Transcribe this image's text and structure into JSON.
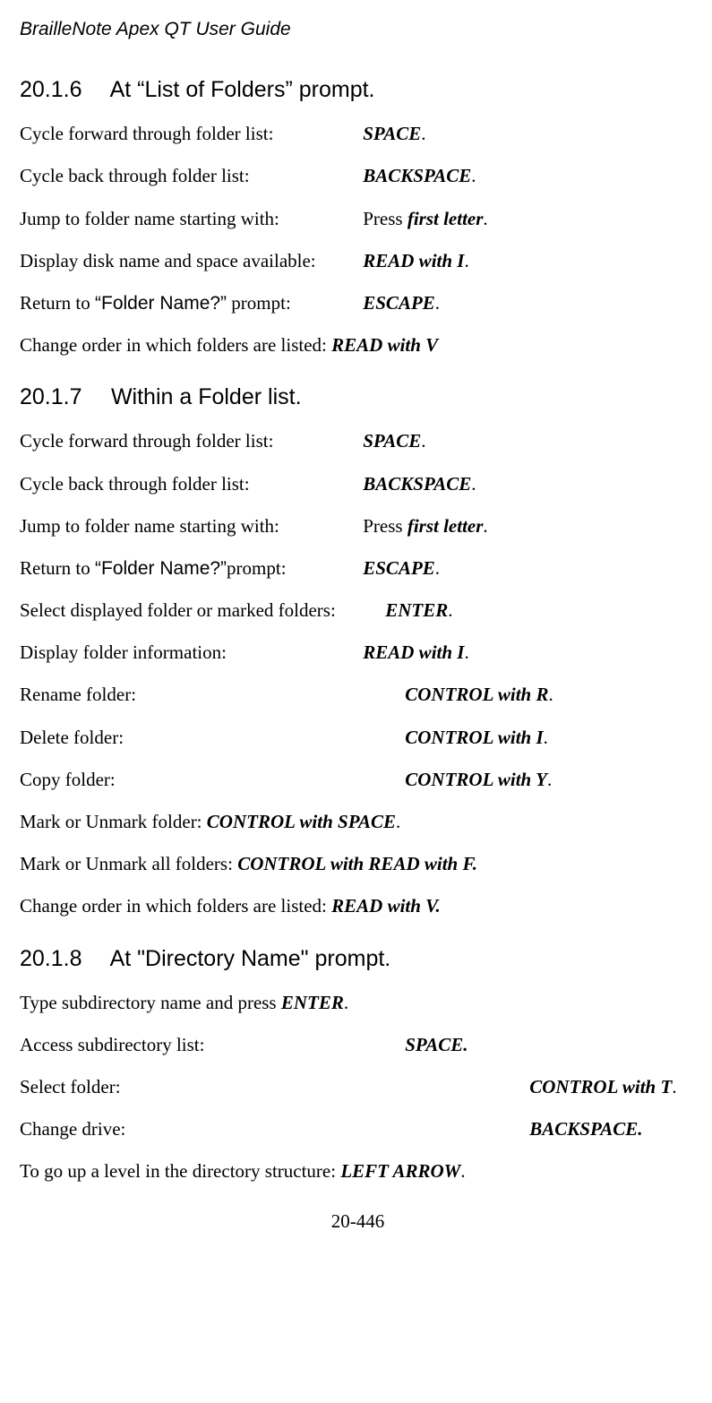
{
  "header": {
    "title": "BrailleNote Apex QT User Guide"
  },
  "sections": {
    "s1": {
      "num": "20.1.6",
      "title": "At “List of Folders” prompt.",
      "entries": {
        "e1": {
          "desc": "Cycle forward through folder list:",
          "key": "SPACE",
          "suffix": "."
        },
        "e2": {
          "desc": "Cycle back through folder list:",
          "key": "BACKSPACE",
          "suffix": "."
        },
        "e3": {
          "desc": "Jump to folder name starting with:",
          "prefix": "Press ",
          "key": "first letter",
          "suffix": "."
        },
        "e4": {
          "desc": "Display disk name and space available:",
          "key": "READ with I",
          "suffix": "."
        },
        "e5": {
          "desc_a": "Return to ",
          "prompt": "“Folder Name?”",
          "desc_b": " prompt:",
          "key": "ESCAPE",
          "suffix": "."
        },
        "e6": {
          "desc": "Change order in which folders are listed: ",
          "key": "READ with V"
        }
      }
    },
    "s2": {
      "num": "20.1.7",
      "title": "Within a Folder list.",
      "entries": {
        "e1": {
          "desc": "Cycle forward through folder list:",
          "key": "SPACE",
          "suffix": "."
        },
        "e2": {
          "desc": "Cycle back through folder list:",
          "key": "BACKSPACE",
          "suffix": "."
        },
        "e3": {
          "desc": "Jump to folder name starting with:",
          "prefix": "Press ",
          "key": "first letter",
          "suffix": "."
        },
        "e4": {
          "desc_a": "Return to ",
          "prompt": "“Folder Name?”",
          "desc_b": "prompt:",
          "key": "ESCAPE",
          "suffix": "."
        },
        "e5": {
          "desc": "Select displayed folder or marked folders:",
          "key": "ENTER",
          "suffix": "."
        },
        "e6": {
          "desc": "Display folder information:",
          "key": "READ with I",
          "suffix": "."
        },
        "e7": {
          "desc": "Rename folder:",
          "key": "CONTROL with R",
          "suffix": "."
        },
        "e8": {
          "desc": "Delete folder:",
          "key": "CONTROL with I",
          "suffix": "."
        },
        "e9": {
          "desc": "Copy folder:",
          "key": "CONTROL with Y",
          "suffix": "."
        },
        "e10": {
          "desc": "Mark or Unmark folder: ",
          "key": "CONTROL with SPACE",
          "suffix": "."
        },
        "e11": {
          "desc": "Mark or Unmark all folders: ",
          "key": "CONTROL with READ with F."
        },
        "e12": {
          "desc": "Change order in which folders are listed: ",
          "key": "READ with V."
        }
      }
    },
    "s3": {
      "num": "20.1.8",
      "title": "At \"Directory Name\" prompt.",
      "entries": {
        "e1": {
          "desc": "Type subdirectory name and press ",
          "key": "ENTER",
          "suffix": "."
        },
        "e2": {
          "desc": "Access subdirectory list:",
          "key": "SPACE."
        },
        "e3": {
          "desc": "Select folder:",
          "key": "CONTROL with T",
          "suffix": "."
        },
        "e4": {
          "desc": "Change drive:",
          "key": "BACKSPACE."
        },
        "e5": {
          "desc": "To go up a level in the directory structure: ",
          "key": "LEFT ARROW",
          "suffix": "."
        }
      }
    }
  },
  "footer": {
    "page": "20-446"
  }
}
